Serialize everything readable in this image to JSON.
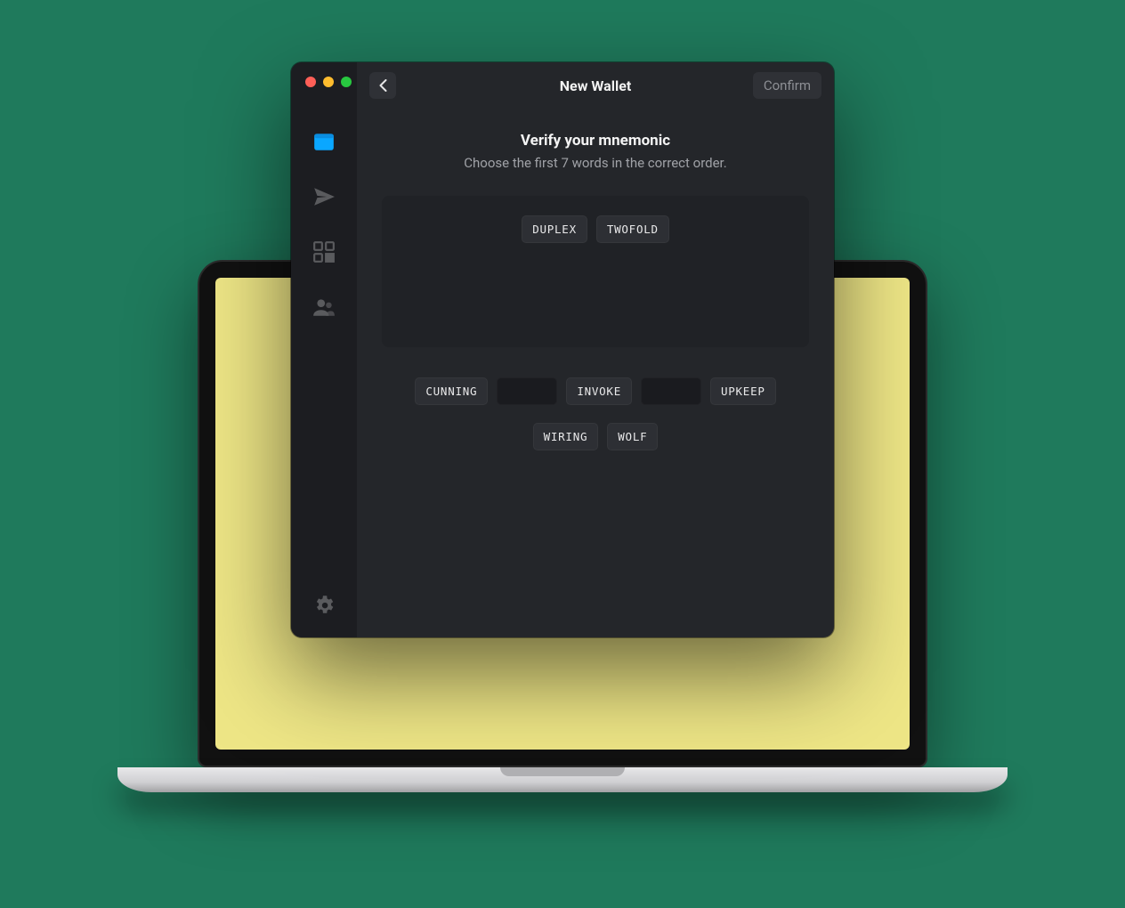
{
  "header": {
    "title": "New Wallet",
    "confirm_label": "Confirm"
  },
  "verify": {
    "title": "Verify your mnemonic",
    "subtitle": "Choose the first 7 words in the correct order."
  },
  "selected_words": [
    "DUPLEX",
    "TWOFOLD"
  ],
  "pool": {
    "row1": [
      "CUNNING",
      "",
      "INVOKE",
      "",
      "UPKEEP"
    ],
    "row2": [
      "WIRING",
      "WOLF"
    ]
  },
  "sidebar": {
    "items": [
      "wallet",
      "send",
      "qr",
      "contacts"
    ],
    "settings": "settings"
  }
}
